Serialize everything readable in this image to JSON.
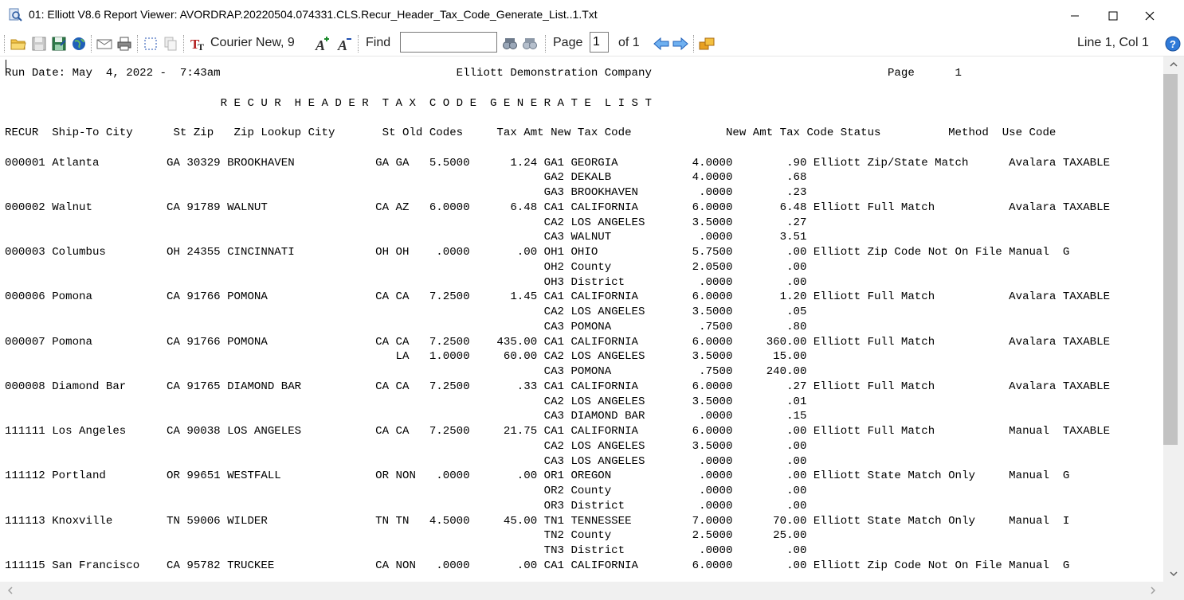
{
  "window": {
    "title": "01: Elliott V8.6 Report Viewer: AVORDRAP.20220504.074331.CLS.Recur_Header_Tax_Code_Generate_List..1.Txt"
  },
  "toolbar": {
    "font_label": "Courier New, 9",
    "find_label": "Find",
    "find_value": "",
    "page_label": "Page",
    "page_value": "1",
    "page_of": "of 1",
    "cursor_position": "Line 1, Col 1",
    "icons": [
      "open-folder-icon",
      "save-icon",
      "save-as-icon",
      "globe-icon",
      "email-icon",
      "print-icon",
      "select-all-icon",
      "copy-icon",
      "font-icon",
      "increase-font-icon",
      "decrease-font-icon",
      "find-next-icon",
      "find-previous-icon",
      "previous-page-icon",
      "next-page-icon",
      "export-icon",
      "help-icon"
    ]
  },
  "report": {
    "lines": [
      "Run Date: May  4, 2022 -  7:43am                                   Elliott Demonstration Company                                   Page      1",
      "",
      "                                R E C U R  H E A D E R  T A X  C O D E  G E N E R A T E  L I S T",
      "",
      "RECUR  Ship-To City      St Zip   Zip Lookup City       St Old Codes     Tax Amt New Tax Code              New Amt Tax Code Status          Method  Use Code",
      "",
      "000001 Atlanta          GA 30329 BROOKHAVEN            GA GA   5.5000      1.24 GA1 GEORGIA           4.0000        .90 Elliott Zip/State Match      Avalara TAXABLE",
      "                                                                                GA2 DEKALB            4.0000        .68",
      "                                                                                GA3 BROOKHAVEN         .0000        .23",
      "000002 Walnut           CA 91789 WALNUT                CA AZ   6.0000      6.48 CA1 CALIFORNIA        6.0000       6.48 Elliott Full Match           Avalara TAXABLE",
      "                                                                                CA2 LOS ANGELES       3.5000        .27",
      "                                                                                CA3 WALNUT             .0000       3.51",
      "000003 Columbus         OH 24355 CINCINNATI            OH OH    .0000       .00 OH1 OHIO              5.7500        .00 Elliott Zip Code Not On File Manual  G",
      "                                                                                OH2 County            2.0500        .00",
      "                                                                                OH3 District           .0000        .00",
      "000006 Pomona           CA 91766 POMONA                CA CA   7.2500      1.45 CA1 CALIFORNIA        6.0000       1.20 Elliott Full Match           Avalara TAXABLE",
      "                                                                                CA2 LOS ANGELES       3.5000        .05",
      "                                                                                CA3 POMONA             .7500        .80",
      "000007 Pomona           CA 91766 POMONA                CA CA   7.2500    435.00 CA1 CALIFORNIA        6.0000     360.00 Elliott Full Match           Avalara TAXABLE",
      "                                                          LA   1.0000     60.00 CA2 LOS ANGELES       3.5000      15.00",
      "                                                                                CA3 POMONA             .7500     240.00",
      "000008 Diamond Bar      CA 91765 DIAMOND BAR           CA CA   7.2500       .33 CA1 CALIFORNIA        6.0000        .27 Elliott Full Match           Avalara TAXABLE",
      "                                                                                CA2 LOS ANGELES       3.5000        .01",
      "                                                                                CA3 DIAMOND BAR        .0000        .15",
      "111111 Los Angeles      CA 90038 LOS ANGELES           CA CA   7.2500     21.75 CA1 CALIFORNIA        6.0000        .00 Elliott Full Match           Manual  TAXABLE",
      "                                                                                CA2 LOS ANGELES       3.5000        .00",
      "                                                                                CA3 LOS ANGELES        .0000        .00",
      "111112 Portland         OR 99651 WESTFALL              OR NON   .0000       .00 OR1 OREGON             .0000        .00 Elliott State Match Only     Manual  G",
      "                                                                                OR2 County             .0000        .00",
      "                                                                                OR3 District           .0000        .00",
      "111113 Knoxville        TN 59006 WILDER                TN TN   4.5000     45.00 TN1 TENNESSEE         7.0000      70.00 Elliott State Match Only     Manual  I",
      "                                                                                TN2 County            2.5000      25.00",
      "                                                                                TN3 District           .0000        .00",
      "111115 San Francisco    CA 95782 TRUCKEE               CA NON   .0000       .00 CA1 CALIFORNIA        6.0000        .00 Elliott Zip Code Not On File Manual  G"
    ]
  }
}
